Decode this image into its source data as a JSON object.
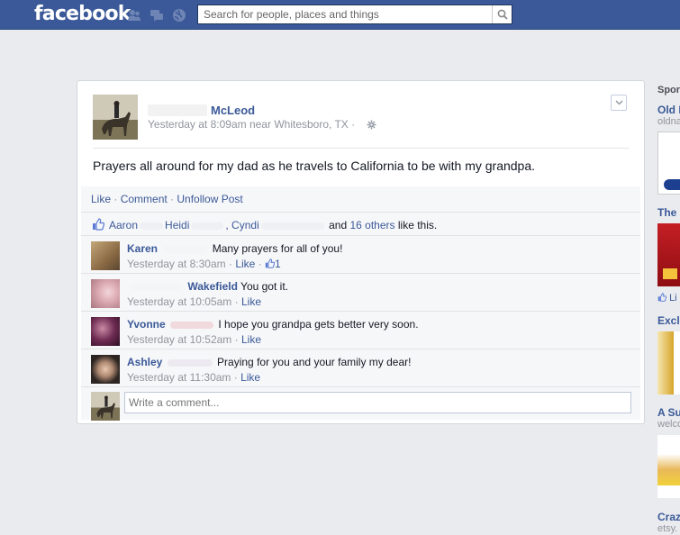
{
  "topbar": {
    "logo": "facebook",
    "search_placeholder": "Search for people, places and things",
    "icons": [
      "friend-requests-icon",
      "messages-icon",
      "notifications-icon",
      "search-icon"
    ]
  },
  "story": {
    "author_name": "McLeod",
    "timestamp": "Yesterday at 8:09am near Whitesboro, TX ·",
    "text": "Prayers all around for my dad as he travels to California to be with my grandpa.",
    "actions": {
      "like": "Like",
      "sep1": " · ",
      "comment": "Comment",
      "sep2": " · ",
      "unfollow": "Unfollow Post"
    },
    "likes": {
      "name1": "Aaron",
      "name2": "Heidi",
      "name3": ", Cyndi",
      "and": "and",
      "others": "16 others",
      "suffix": "like this."
    },
    "comments": [
      {
        "name": "Karen",
        "text": "Many prayers for all of you!",
        "time": "Yesterday at 8:30am",
        "like": "Like",
        "like_count": "1"
      },
      {
        "name": "Wakefield",
        "text": "You got it.",
        "time": "Yesterday at 10:05am",
        "like": "Like"
      },
      {
        "name": "Yvonne",
        "text": "I hope you grandpa gets better very soon.",
        "time": "Yesterday at 10:52am",
        "like": "Like"
      },
      {
        "name": "Ashley",
        "text": "Praying for you and your family my dear!",
        "time": "Yesterday at 11:30am",
        "like": "Like"
      }
    ],
    "write_placeholder": "Write a comment..."
  },
  "rightcol": {
    "heading": "Spor",
    "ads": [
      {
        "title": "Old I",
        "sub": "oldna"
      },
      {
        "title": "The",
        "sub": ""
      },
      {
        "title": "Exclu",
        "sub": ""
      },
      {
        "title": "A Su",
        "sub": "welco"
      },
      {
        "title": "Craz",
        "sub": "etsy."
      }
    ],
    "like_label": "Li"
  },
  "colors": {
    "brand": "#3b5998",
    "link": "#3b5998",
    "meta": "#90949c",
    "ufi_bg": "#f6f7f9"
  }
}
